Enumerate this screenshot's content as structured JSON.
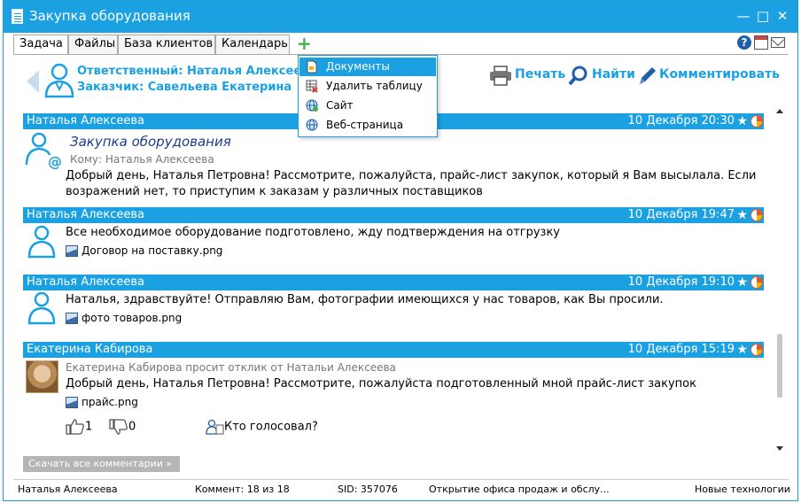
{
  "window": {
    "title": "Закупка оборудования"
  },
  "tabs": [
    {
      "label": "Задача"
    },
    {
      "label": "Файлы"
    },
    {
      "label": "База клиентов"
    },
    {
      "label": "Календарь"
    }
  ],
  "header": {
    "responsible": "Ответственный: Наталья Алексеева",
    "customer": "Заказчик: Савельева Екатерина",
    "actions": {
      "print": "Печать",
      "find": "Найти",
      "comment": "Комментировать"
    }
  },
  "dropdown": {
    "items": [
      {
        "label": "Документы",
        "icon": "document-icon"
      },
      {
        "label": "Удалить таблицу",
        "icon": "delete-table-icon"
      },
      {
        "label": "Сайт",
        "icon": "globe-icon"
      },
      {
        "label": "Веб-страница",
        "icon": "web-page-icon"
      }
    ]
  },
  "messages": [
    {
      "author": "Наталья Алексеева",
      "date": "10 Декабря 20:30",
      "subject": "Закупка оборудования",
      "to": "Кому: Наталья Алексеева",
      "body": "Добрый день, Наталья Петровна! Рассмотрите, пожалуйста, прайс-лист закупок, который я Вам высылала. Если возражений нет, то приступим к заказам у различных поставщиков"
    },
    {
      "author": "Наталья Алексеева",
      "date": "10 Декабря 19:47",
      "body": "Все необходимое оборудование подготовлено, жду подтверждения на отгрузку",
      "attachment": "Договор на поставку.png"
    },
    {
      "author": "Наталья Алексеева",
      "date": "10 Декабря 19:10",
      "body": "Наталья, здравствуйте! Отправляю Вам, фотографии имеющихся у нас товаров, как Вы просили.",
      "attachment": "фото товаров.png"
    },
    {
      "author": "Екатерина Кабирова",
      "date": "10 Декабря 15:19",
      "request": "Екатерина Кабирова просит отклик от Натальи Алексеева",
      "body": "Добрый день, Наталья Петровна! Рассмотрите, пожалуйста подготовленный мной прайс-лист закупок",
      "attachment": "прайс.png",
      "likes": "1",
      "dislikes": "0",
      "who_voted": "Кто голосовал?"
    }
  ],
  "download_all": "Скачать все комментарии",
  "status": {
    "user": "Наталья Алексеева",
    "comment": "Коммент: 18 из 18",
    "sid": "SID: 357076",
    "task": "Открытие офиса продаж и обслу...",
    "company": "Новые технологии"
  },
  "colors": {
    "accent": "#1ba1e2",
    "subject": "#1f3b8f"
  }
}
